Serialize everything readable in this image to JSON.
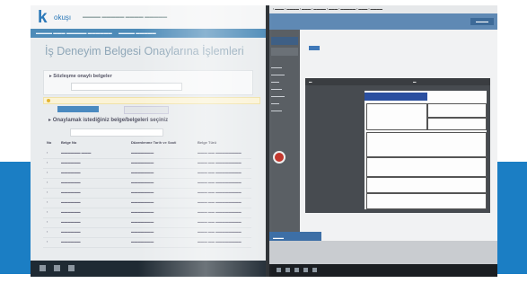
{
  "left_screen": {
    "logo_mark": "k",
    "logo_text": "okuşı",
    "title": "İş Deneyim Belgesi Onaylarına İşlemleri",
    "panel1_heading": "Sözleşme onaylı belgeler",
    "panel2_heading": "Onaylamak istediğiniz belge/belgeleri seçiniz",
    "table_headers": [
      "No",
      "Belge No",
      "Düzenlenme Tarih ve Saati",
      "Belge Türü"
    ]
  }
}
